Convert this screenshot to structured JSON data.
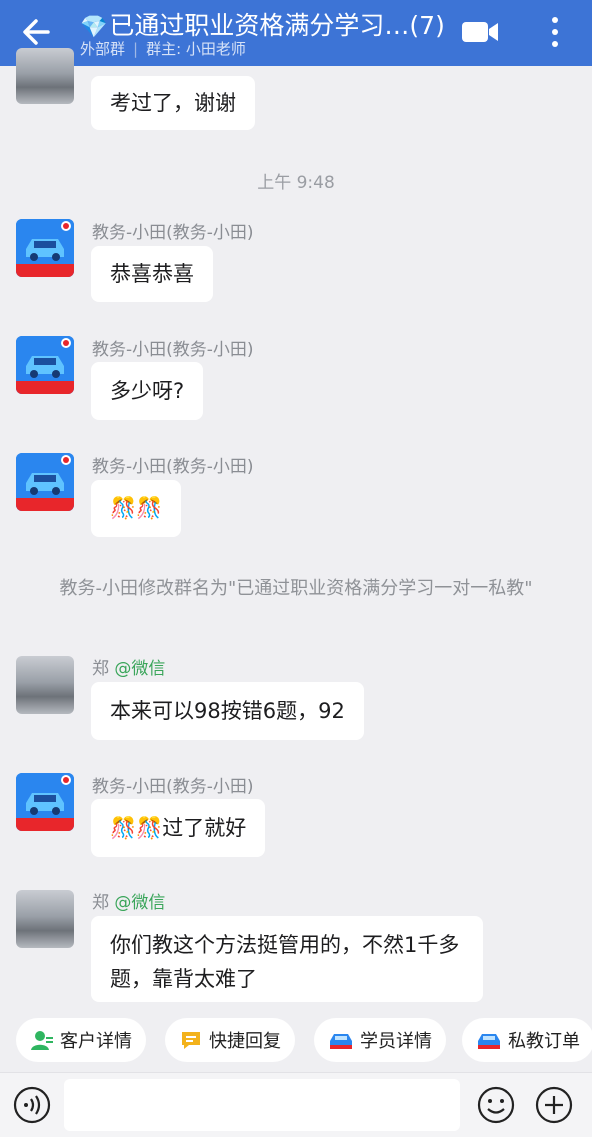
{
  "header": {
    "title": "已通过职业资格满分学习…(7)",
    "subtitle_left": "外部群",
    "subtitle_sep": "|",
    "subtitle_right": "群主: 小田老师"
  },
  "messages": [
    {
      "kind": "text",
      "text": "考过了，谢谢"
    },
    {
      "kind": "time",
      "text": "上午 9:48"
    },
    {
      "kind": "text",
      "sender": "教务-小田(教务-小田)",
      "text": "恭喜恭喜"
    },
    {
      "kind": "text",
      "sender": "教务-小田(教务-小田)",
      "text": "多少呀?"
    },
    {
      "kind": "text",
      "sender": "教务-小田(教务-小田)",
      "text": "🎊🎊"
    },
    {
      "kind": "system",
      "text": "教务-小田修改群名为\"已通过职业资格满分学习一对一私教\""
    },
    {
      "kind": "text",
      "sender": "郑",
      "sender_tag": "@微信",
      "text": "本来可以98按错6题，92"
    },
    {
      "kind": "text",
      "sender": "教务-小田(教务-小田)",
      "text": "🎊🎊过了就好"
    },
    {
      "kind": "text",
      "sender": "郑",
      "sender_tag": "@微信",
      "text": "你们教这个方法挺管用的，不然1千多题，靠背太难了"
    }
  ],
  "avatar_badge": "驾考宝典",
  "quick_actions": [
    "客户详情",
    "快捷回复",
    "学员详情",
    "私教订单"
  ],
  "input": {
    "placeholder": ""
  },
  "colors": {
    "header": "#3d74d6",
    "background": "#efeff2",
    "wechat_tag": "#3aa55a"
  }
}
